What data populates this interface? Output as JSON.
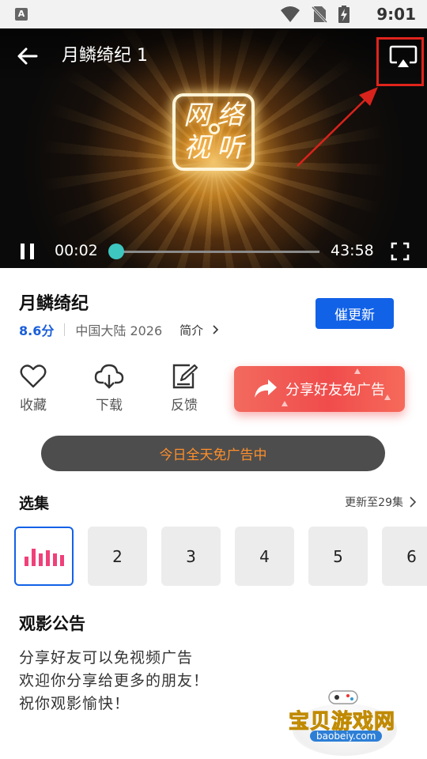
{
  "status_bar": {
    "app_icon_letter": "A",
    "time": "9:01"
  },
  "player": {
    "title": "月鳞绮纪 1",
    "current_time": "00:02",
    "total_time": "43:58",
    "progress": 0.0008,
    "logo_chars": [
      "网",
      "络",
      "视",
      "听"
    ]
  },
  "show": {
    "title": "月鳞绮纪",
    "score": "8.6分",
    "region_year": "中国大陆  2026",
    "intro_label": "简介",
    "urge_update_label": "催更新"
  },
  "actions": {
    "favorite": "收藏",
    "download": "下载",
    "feedback": "反馈",
    "share": "分享好友免广告"
  },
  "ad_free_status": "今日全天免广告中",
  "episodes": {
    "header": "选集",
    "update_text": "更新至29集",
    "items": [
      "2",
      "3",
      "4",
      "5",
      "6"
    ]
  },
  "notice": {
    "title": "观影公告",
    "lines": [
      "分享好友可以免视频广告",
      "欢迎你分享给更多的朋友！",
      "祝你观影愉快！"
    ]
  },
  "watermark": {
    "text": "宝贝游戏网",
    "url": "baobeiy.com"
  },
  "colors": {
    "accent_blue": "#1262e8",
    "seek_teal": "#3ec6c0",
    "share_red": "#f04c4c",
    "noads_orange": "#ff8f2a",
    "highlight_red": "#e0241c"
  }
}
